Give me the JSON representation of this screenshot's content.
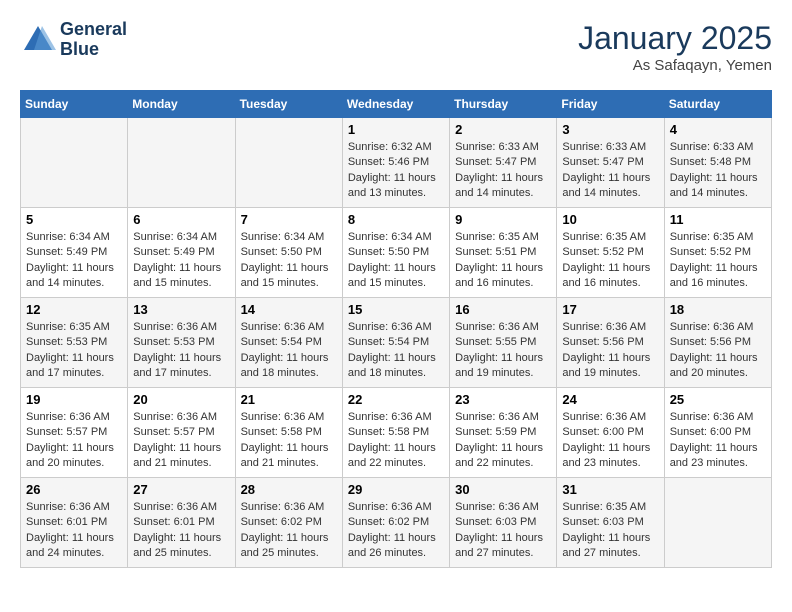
{
  "logo": {
    "line1": "General",
    "line2": "Blue"
  },
  "title": "January 2025",
  "subtitle": "As Safaqayn, Yemen",
  "header": {
    "days": [
      "Sunday",
      "Monday",
      "Tuesday",
      "Wednesday",
      "Thursday",
      "Friday",
      "Saturday"
    ]
  },
  "weeks": [
    {
      "cells": [
        {
          "day": "",
          "info": ""
        },
        {
          "day": "",
          "info": ""
        },
        {
          "day": "",
          "info": ""
        },
        {
          "day": "1",
          "info": "Sunrise: 6:32 AM\nSunset: 5:46 PM\nDaylight: 11 hours\nand 13 minutes."
        },
        {
          "day": "2",
          "info": "Sunrise: 6:33 AM\nSunset: 5:47 PM\nDaylight: 11 hours\nand 14 minutes."
        },
        {
          "day": "3",
          "info": "Sunrise: 6:33 AM\nSunset: 5:47 PM\nDaylight: 11 hours\nand 14 minutes."
        },
        {
          "day": "4",
          "info": "Sunrise: 6:33 AM\nSunset: 5:48 PM\nDaylight: 11 hours\nand 14 minutes."
        }
      ]
    },
    {
      "cells": [
        {
          "day": "5",
          "info": "Sunrise: 6:34 AM\nSunset: 5:49 PM\nDaylight: 11 hours\nand 14 minutes."
        },
        {
          "day": "6",
          "info": "Sunrise: 6:34 AM\nSunset: 5:49 PM\nDaylight: 11 hours\nand 15 minutes."
        },
        {
          "day": "7",
          "info": "Sunrise: 6:34 AM\nSunset: 5:50 PM\nDaylight: 11 hours\nand 15 minutes."
        },
        {
          "day": "8",
          "info": "Sunrise: 6:34 AM\nSunset: 5:50 PM\nDaylight: 11 hours\nand 15 minutes."
        },
        {
          "day": "9",
          "info": "Sunrise: 6:35 AM\nSunset: 5:51 PM\nDaylight: 11 hours\nand 16 minutes."
        },
        {
          "day": "10",
          "info": "Sunrise: 6:35 AM\nSunset: 5:52 PM\nDaylight: 11 hours\nand 16 minutes."
        },
        {
          "day": "11",
          "info": "Sunrise: 6:35 AM\nSunset: 5:52 PM\nDaylight: 11 hours\nand 16 minutes."
        }
      ]
    },
    {
      "cells": [
        {
          "day": "12",
          "info": "Sunrise: 6:35 AM\nSunset: 5:53 PM\nDaylight: 11 hours\nand 17 minutes."
        },
        {
          "day": "13",
          "info": "Sunrise: 6:36 AM\nSunset: 5:53 PM\nDaylight: 11 hours\nand 17 minutes."
        },
        {
          "day": "14",
          "info": "Sunrise: 6:36 AM\nSunset: 5:54 PM\nDaylight: 11 hours\nand 18 minutes."
        },
        {
          "day": "15",
          "info": "Sunrise: 6:36 AM\nSunset: 5:54 PM\nDaylight: 11 hours\nand 18 minutes."
        },
        {
          "day": "16",
          "info": "Sunrise: 6:36 AM\nSunset: 5:55 PM\nDaylight: 11 hours\nand 19 minutes."
        },
        {
          "day": "17",
          "info": "Sunrise: 6:36 AM\nSunset: 5:56 PM\nDaylight: 11 hours\nand 19 minutes."
        },
        {
          "day": "18",
          "info": "Sunrise: 6:36 AM\nSunset: 5:56 PM\nDaylight: 11 hours\nand 20 minutes."
        }
      ]
    },
    {
      "cells": [
        {
          "day": "19",
          "info": "Sunrise: 6:36 AM\nSunset: 5:57 PM\nDaylight: 11 hours\nand 20 minutes."
        },
        {
          "day": "20",
          "info": "Sunrise: 6:36 AM\nSunset: 5:57 PM\nDaylight: 11 hours\nand 21 minutes."
        },
        {
          "day": "21",
          "info": "Sunrise: 6:36 AM\nSunset: 5:58 PM\nDaylight: 11 hours\nand 21 minutes."
        },
        {
          "day": "22",
          "info": "Sunrise: 6:36 AM\nSunset: 5:58 PM\nDaylight: 11 hours\nand 22 minutes."
        },
        {
          "day": "23",
          "info": "Sunrise: 6:36 AM\nSunset: 5:59 PM\nDaylight: 11 hours\nand 22 minutes."
        },
        {
          "day": "24",
          "info": "Sunrise: 6:36 AM\nSunset: 6:00 PM\nDaylight: 11 hours\nand 23 minutes."
        },
        {
          "day": "25",
          "info": "Sunrise: 6:36 AM\nSunset: 6:00 PM\nDaylight: 11 hours\nand 23 minutes."
        }
      ]
    },
    {
      "cells": [
        {
          "day": "26",
          "info": "Sunrise: 6:36 AM\nSunset: 6:01 PM\nDaylight: 11 hours\nand 24 minutes."
        },
        {
          "day": "27",
          "info": "Sunrise: 6:36 AM\nSunset: 6:01 PM\nDaylight: 11 hours\nand 25 minutes."
        },
        {
          "day": "28",
          "info": "Sunrise: 6:36 AM\nSunset: 6:02 PM\nDaylight: 11 hours\nand 25 minutes."
        },
        {
          "day": "29",
          "info": "Sunrise: 6:36 AM\nSunset: 6:02 PM\nDaylight: 11 hours\nand 26 minutes."
        },
        {
          "day": "30",
          "info": "Sunrise: 6:36 AM\nSunset: 6:03 PM\nDaylight: 11 hours\nand 27 minutes."
        },
        {
          "day": "31",
          "info": "Sunrise: 6:35 AM\nSunset: 6:03 PM\nDaylight: 11 hours\nand 27 minutes."
        },
        {
          "day": "",
          "info": ""
        }
      ]
    }
  ]
}
